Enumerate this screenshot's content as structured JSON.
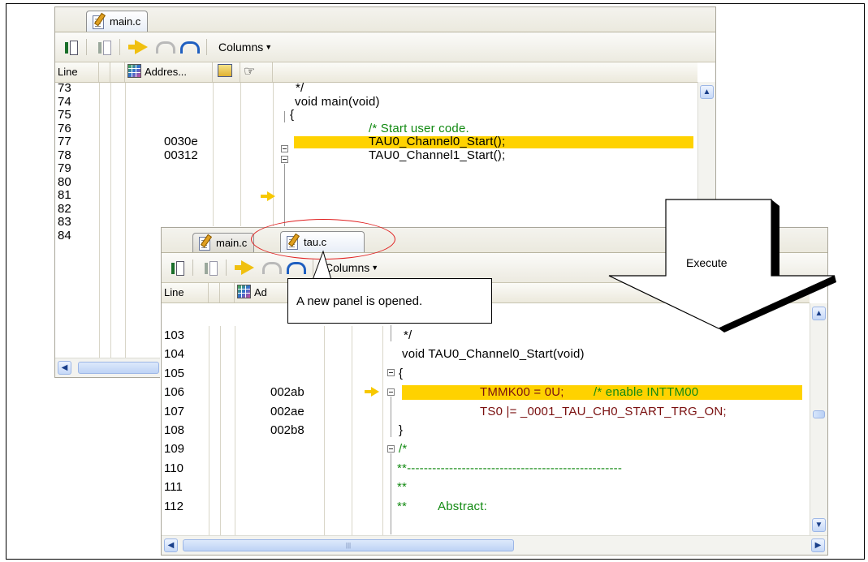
{
  "back_panel": {
    "tab_label": "main.c",
    "columns_label": "Columns",
    "header": {
      "line": "Line",
      "address": "Addres..."
    },
    "rows": [
      {
        "line": "73",
        "address": "",
        "code": "*/"
      },
      {
        "line": "74",
        "address": "",
        "code": "void main(void)"
      },
      {
        "line": "75",
        "address": "",
        "code": "{"
      },
      {
        "line": "76",
        "address": "",
        "code": "/* Start user code."
      },
      {
        "line": "77",
        "address": "0030e",
        "code": "TAU0_Channel0_Start();"
      },
      {
        "line": "78",
        "address": "00312",
        "code": "TAU0_Channel1_Start();"
      },
      {
        "line": "79",
        "address": "",
        "code": ""
      },
      {
        "line": "80",
        "address": "",
        "code": ""
      },
      {
        "line": "81",
        "address": "",
        "code": ""
      },
      {
        "line": "82",
        "address": "",
        "code": ""
      },
      {
        "line": "83",
        "address": "",
        "code": ""
      },
      {
        "line": "84",
        "address": "",
        "code": ""
      }
    ]
  },
  "front_panel": {
    "tabs": [
      "main.c",
      "tau.c"
    ],
    "columns_label": "Columns",
    "header": {
      "line": "Line",
      "address": "Ad"
    },
    "rows": [
      {
        "line": "103",
        "address": "",
        "code": "*/"
      },
      {
        "line": "104",
        "address": "",
        "code": "void TAU0_Channel0_Start(void)"
      },
      {
        "line": "105",
        "address": "",
        "code": "{"
      },
      {
        "line": "106",
        "address": "002ab",
        "code_a": "TMMK00 = 0U;",
        "code_b": "/* enable INTTM00"
      },
      {
        "line": "107",
        "address": "002ae",
        "code": "TS0 |= _0001_TAU_CH0_START_TRG_ON;"
      },
      {
        "line": "108",
        "address": "002b8",
        "code": "}"
      },
      {
        "line": "109",
        "address": "",
        "code": "/*"
      },
      {
        "line": "110",
        "address": "",
        "code": "**---------------------------------------------------"
      },
      {
        "line": "111",
        "address": "",
        "code": "**"
      },
      {
        "line": "112",
        "address": "",
        "code_a": "**",
        "code_b": "Abstract:"
      }
    ]
  },
  "annotations": {
    "callout": "A new panel is opened.",
    "execute": "Execute"
  },
  "colors": {
    "highlight": "#ffd200",
    "keyword": "#7a1010",
    "comment": "#128a12",
    "ellipse": "#e02020"
  }
}
